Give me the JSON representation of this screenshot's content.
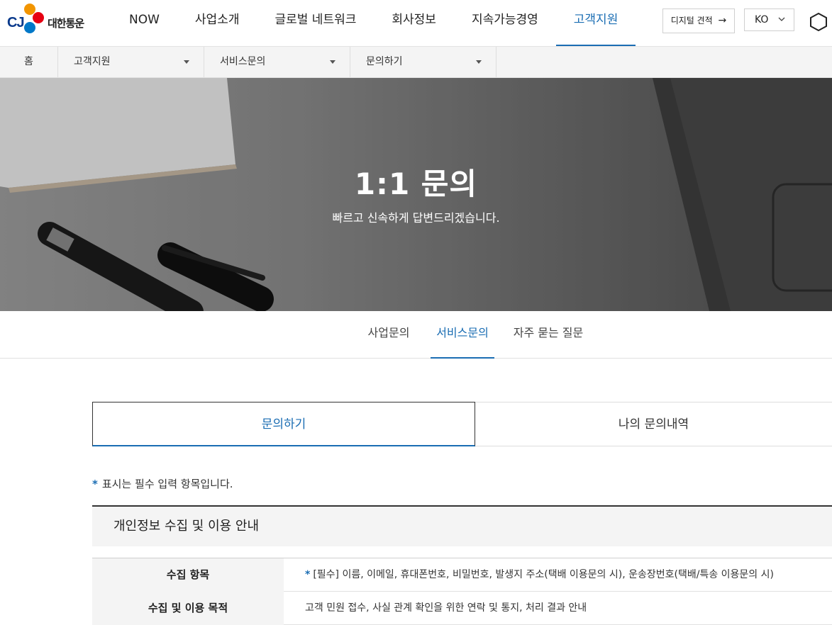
{
  "header": {
    "logo_text": "대한통운",
    "logo_mark": "CJ",
    "nav": [
      {
        "label": "NOW",
        "active": false
      },
      {
        "label": "사업소개",
        "active": false
      },
      {
        "label": "글로벌 네트워크",
        "active": false
      },
      {
        "label": "회사정보",
        "active": false
      },
      {
        "label": "지속가능경영",
        "active": false
      },
      {
        "label": "고객지원",
        "active": true
      }
    ],
    "estimate_label": "디지털 견적",
    "estimate_arrow": "→",
    "lang_label": "KO",
    "accent_color": "#1a6db3"
  },
  "breadcrumb": {
    "home": "홈",
    "items": [
      "고객지원",
      "서비스문의",
      "문의하기"
    ]
  },
  "hero": {
    "title": "1:1 문의",
    "subtitle": "빠르고 신속하게 답변드리겠습니다."
  },
  "subtabs": [
    {
      "label": "사업문의",
      "active": false
    },
    {
      "label": "서비스문의",
      "active": true
    },
    {
      "label": "자주 묻는 질문",
      "active": false
    }
  ],
  "inquiry_tabs": [
    {
      "label": "문의하기",
      "active": true
    },
    {
      "label": "나의 문의내역",
      "active": false
    }
  ],
  "required_note": {
    "star": "*",
    "text": "표시는 필수 입력 항목입니다."
  },
  "privacy": {
    "title": "개인정보 수집 및 이용 안내",
    "rows": [
      {
        "label": "수집 항목",
        "star": "*",
        "value": "[필수] 이름, 이메일, 휴대폰번호, 비밀번호, 발생지 주소(택배 이용문의 시), 운송장번호(택배/특송 이용문의 시)"
      },
      {
        "label": "수집 및 이용 목적",
        "star": "",
        "value": "고객 민원 접수, 사실 관계 확인을 위한 연락 및 통지, 처리 결과 안내"
      }
    ]
  }
}
